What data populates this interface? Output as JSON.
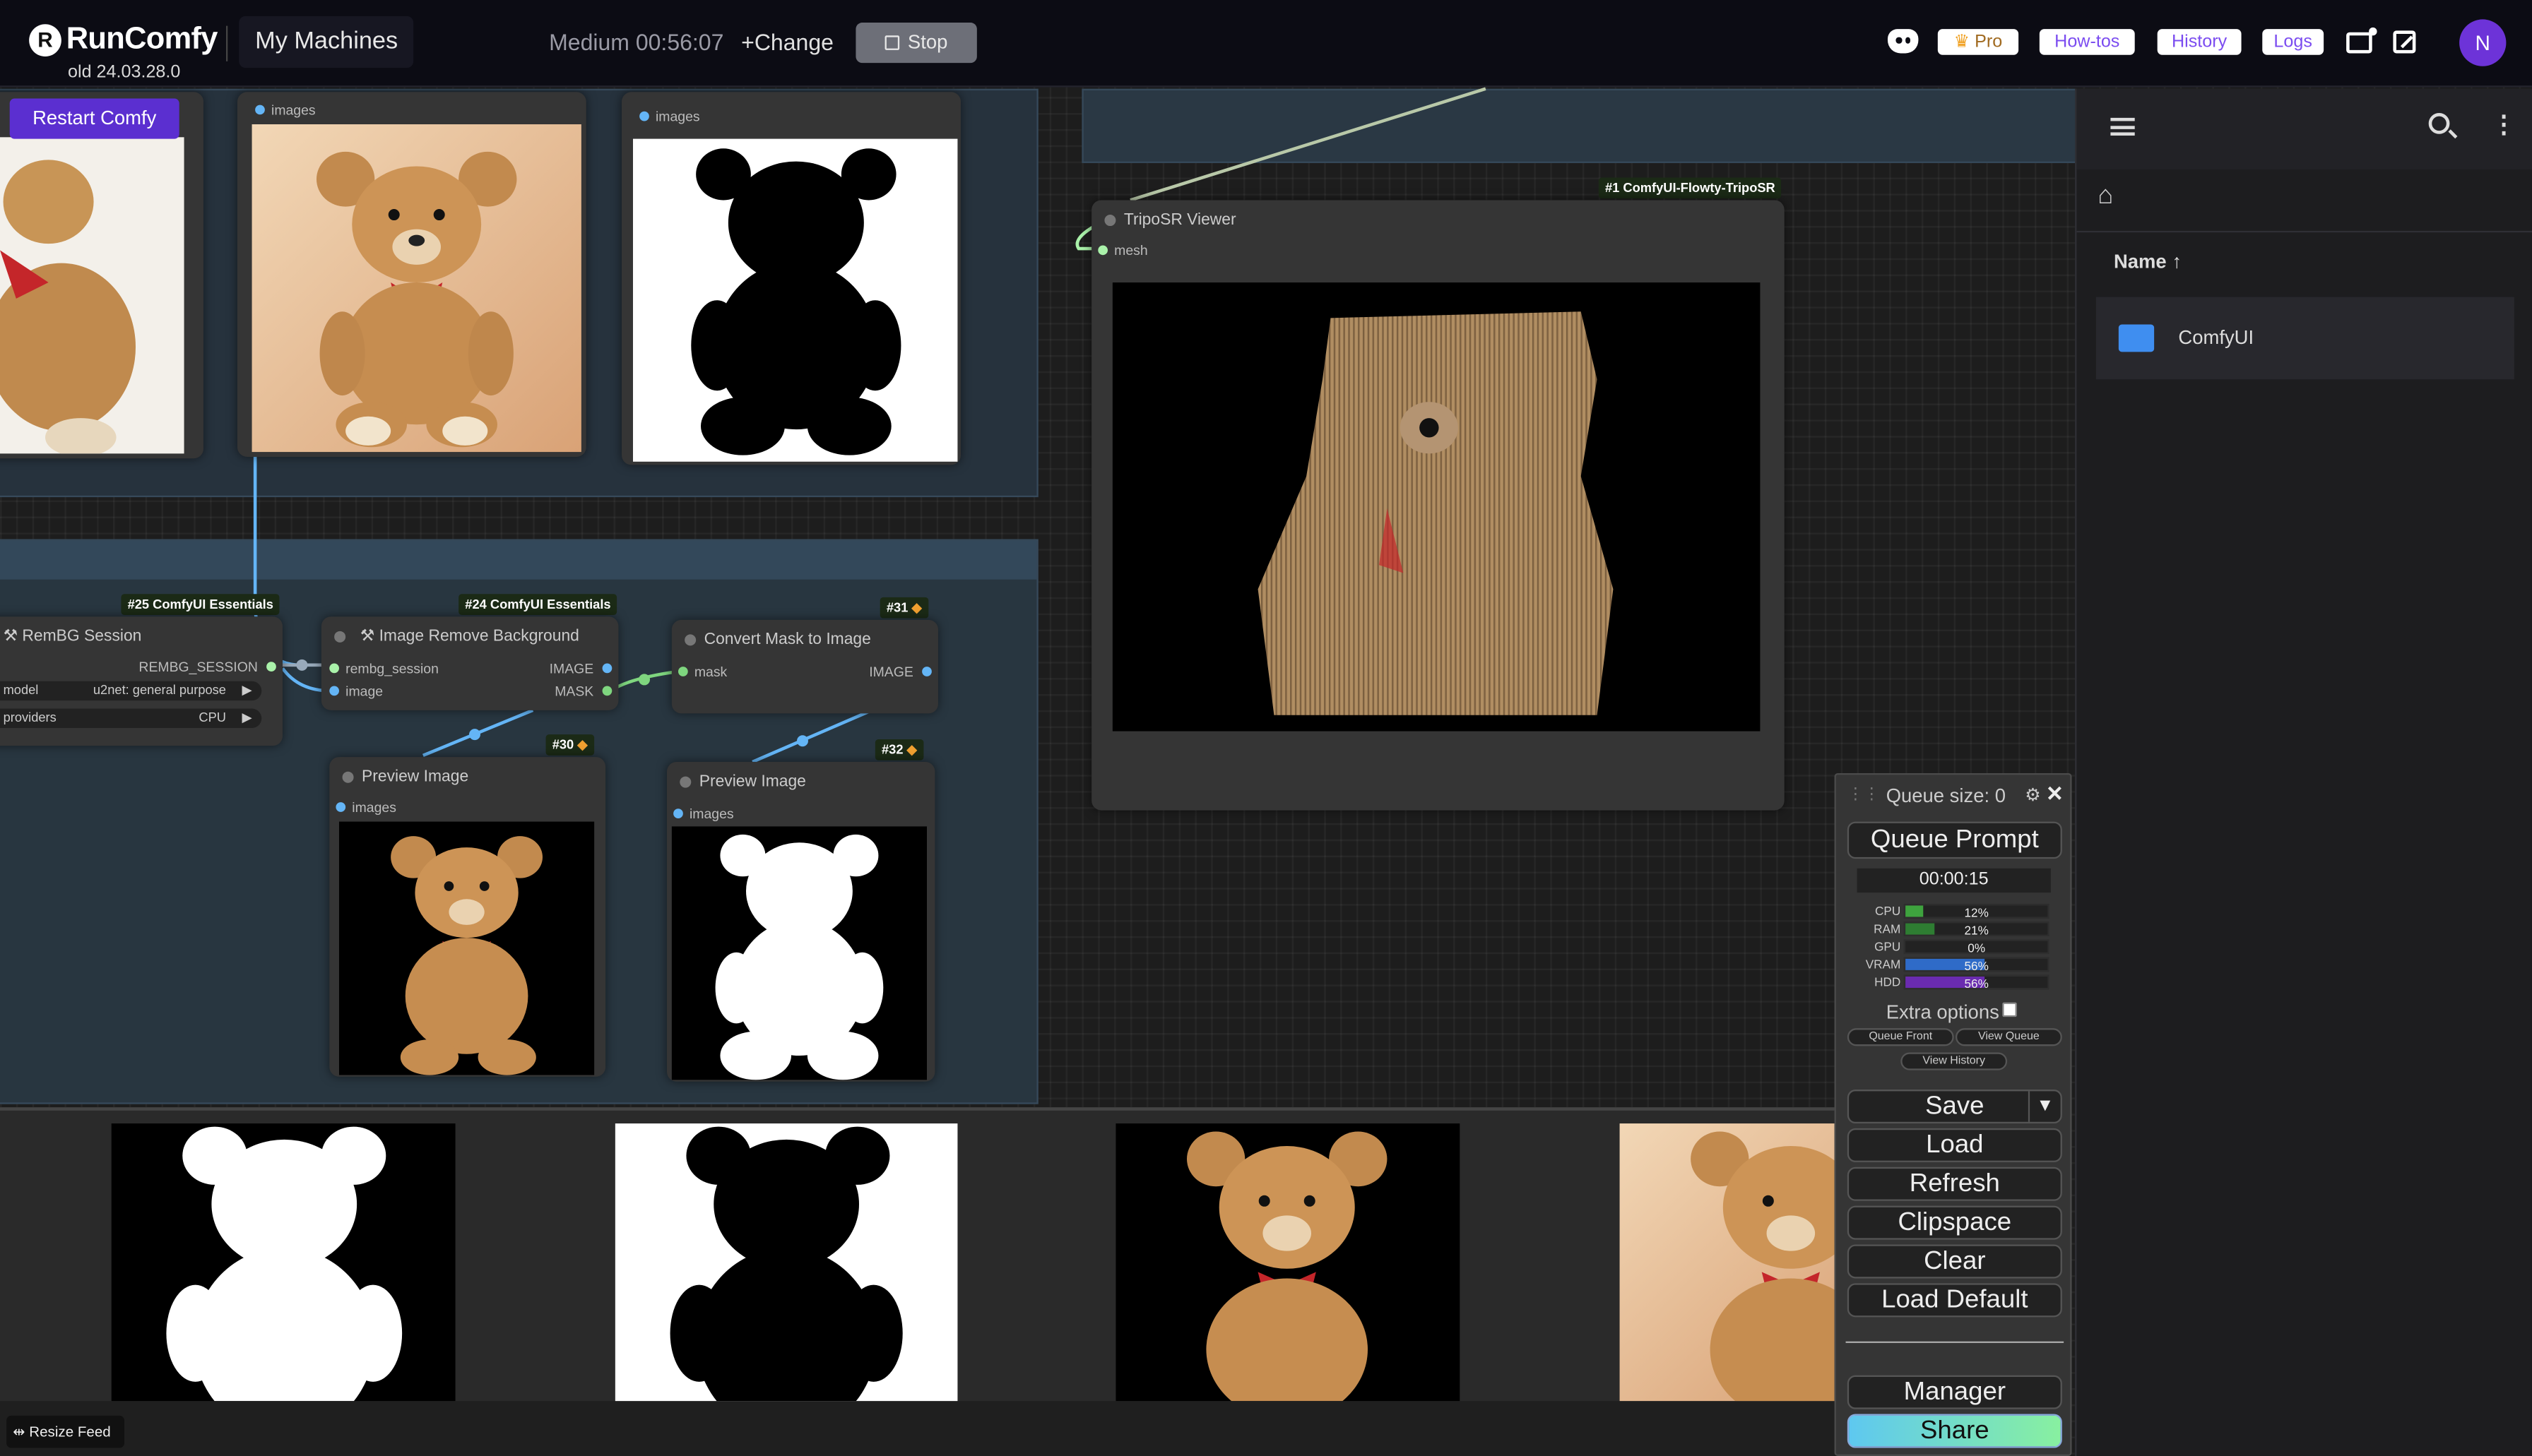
{
  "topbar": {
    "brand": "RunComfy",
    "version": "old 24.03.28.0",
    "my_machines": "My Machines",
    "machine_status": "Medium  00:56:07",
    "change_label": "+Change",
    "stop_label": "Stop",
    "links": {
      "pro": "Pro",
      "howtos": "How-tos",
      "history": "History",
      "logs": "Logs"
    },
    "avatar_letter": "N"
  },
  "canvas": {
    "restart_label": "Restart Comfy",
    "nodes": {
      "preview_left": {
        "port": "images"
      },
      "preview_mask_top": {
        "port": "images"
      },
      "tripo": {
        "badge": "#1 ComfyUI-Flowty-TripoSR",
        "title": "TripoSR Viewer",
        "port": "mesh"
      },
      "rembg_session": {
        "badge": "#25 ComfyUI Essentials",
        "title": "RemBG Session",
        "output": "REMBG_SESSION",
        "w_model_label": "model",
        "w_model_value": "u2net: general purpose",
        "w_providers_label": "providers",
        "w_providers_value": "CPU"
      },
      "remove_bg": {
        "badge": "#24 ComfyUI Essentials",
        "title": "Image Remove Background",
        "in1": "rembg_session",
        "in2": "image",
        "out1": "IMAGE",
        "out2": "MASK"
      },
      "convert_mask": {
        "badge": "#31",
        "title": "Convert Mask to Image",
        "in1": "mask",
        "out1": "IMAGE"
      },
      "preview30": {
        "badge": "#30",
        "title": "Preview Image",
        "port": "images"
      },
      "preview32": {
        "badge": "#32",
        "title": "Preview Image",
        "port": "images"
      }
    }
  },
  "queue": {
    "size_label": "Queue size: 0",
    "queue_prompt": "Queue Prompt",
    "timer": "00:00:15",
    "stats": [
      {
        "name": "CPU",
        "value": "12%",
        "fraction": 0.12,
        "color": "#3ea33e"
      },
      {
        "name": "RAM",
        "value": "21%",
        "fraction": 0.21,
        "color": "#2e7d32"
      },
      {
        "name": "GPU",
        "value": "0%",
        "fraction": 0.0,
        "color": "#3ea33e"
      },
      {
        "name": "VRAM",
        "value": "56%",
        "fraction": 0.56,
        "color": "#2f6bc8"
      },
      {
        "name": "HDD",
        "value": "56%",
        "fraction": 0.56,
        "color": "#6a2bb0"
      }
    ],
    "extra_options": "Extra options",
    "queue_front": "Queue Front",
    "view_queue": "View Queue",
    "view_history": "View History",
    "save": "Save",
    "load": "Load",
    "refresh": "Refresh",
    "clipspace": "Clipspace",
    "clear": "Clear",
    "load_default": "Load Default",
    "manager": "Manager",
    "share": "Share"
  },
  "feed": {
    "resize_label": "Resize Feed"
  },
  "files": {
    "name_header": "Name",
    "items": [
      "ComfyUI"
    ]
  }
}
